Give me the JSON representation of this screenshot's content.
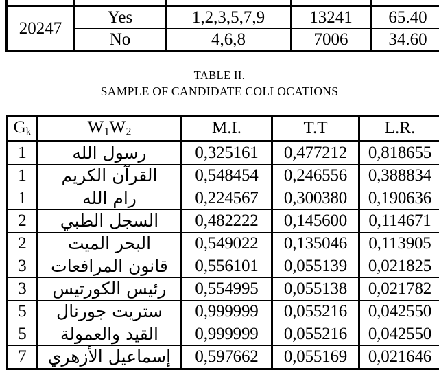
{
  "document": {
    "type": "academic-paper-page-fragment",
    "page_background": "#ffffff",
    "text_color": "#000000"
  },
  "table_one": {
    "note": "Table partially cut off at the top edge of the screenshot; its header row is clipped and illegible.",
    "header": {
      "id_label": "",
      "relevant_label": "",
      "clusters_label": "",
      "freq_label": "",
      "pct_label": ""
    },
    "rows": [
      {
        "id": "20247",
        "id_rowspan": 2,
        "relevant": "Yes",
        "clusters": "1,2,3,5,7,9",
        "frequency": "13241",
        "percentage": "65.40"
      },
      {
        "relevant": "No",
        "clusters": "4,6,8",
        "frequency": "7006",
        "percentage": "34.60"
      }
    ]
  },
  "caption": {
    "number": "TABLE II.",
    "title": "SAMPLE OF CANDIDATE COLLOCATIONS"
  },
  "table_two": {
    "columns": [
      {
        "key": "gk",
        "label_prefix": "G",
        "label_sub": "k"
      },
      {
        "key": "w1w2",
        "label_prefix": "W",
        "label_sub": "1",
        "label_prefix2": "W",
        "label_sub2": "2"
      },
      {
        "key": "mi",
        "label": "M.I."
      },
      {
        "key": "tt",
        "label": "T.T"
      },
      {
        "key": "lr",
        "label": "L.R."
      }
    ],
    "rows": [
      {
        "gk": "1",
        "w1w2": "رسول الله",
        "mi": "0,325161",
        "tt": "0,477212",
        "lr": "0,818655"
      },
      {
        "gk": "1",
        "w1w2": "القرآن الكريم",
        "mi": "0,548454",
        "tt": "0,246556",
        "lr": "0,388834"
      },
      {
        "gk": "1",
        "w1w2": "رام الله",
        "mi": "0,224567",
        "tt": "0,300380",
        "lr": "0,190636"
      },
      {
        "gk": "2",
        "w1w2": "السجل الطبي",
        "mi": "0,482222",
        "tt": "0,145600",
        "lr": "0,114671"
      },
      {
        "gk": "2",
        "w1w2": "البحر الميت",
        "mi": "0,549022",
        "tt": "0,135046",
        "lr": "0,113905"
      },
      {
        "gk": "3",
        "w1w2": "قانون المرافعات",
        "mi": "0,556101",
        "tt": "0,055139",
        "lr": "0,021825"
      },
      {
        "gk": "3",
        "w1w2": "رئيس الكورتيس",
        "mi": "0,554995",
        "tt": "0,055138",
        "lr": "0,021782"
      },
      {
        "gk": "5",
        "w1w2": "ستريت جورنال",
        "mi": "0,999999",
        "tt": "0,055216",
        "lr": "0,042550"
      },
      {
        "gk": "5",
        "w1w2": "القيد والعمولة",
        "mi": "0,999999",
        "tt": "0,055216",
        "lr": "0,042550"
      },
      {
        "gk": "7",
        "w1w2": "إسماعيل الأزهري",
        "mi": "0,597662",
        "tt": "0,055169",
        "lr": "0,021646"
      }
    ]
  }
}
